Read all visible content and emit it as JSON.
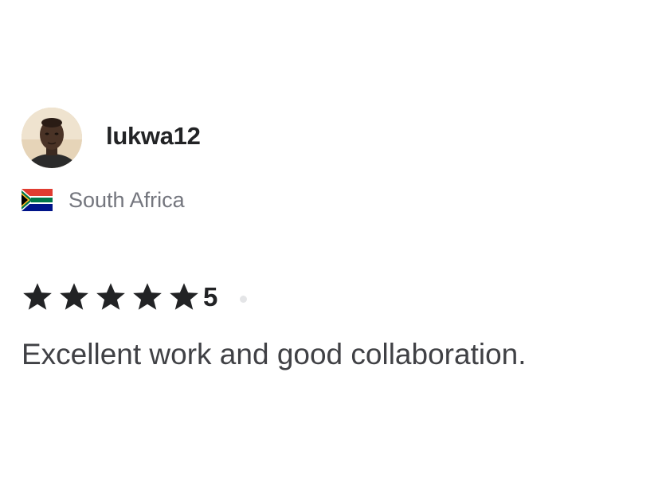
{
  "reviewer": {
    "username": "lukwa12",
    "country": "South Africa",
    "avatar_icon": "user-avatar-photo",
    "flag_icon": "south-africa-flag-icon"
  },
  "rating": {
    "stars": 5,
    "max_stars": 5,
    "value": "5",
    "star_color": "#222325"
  },
  "review": {
    "text": "Excellent work and good collaboration."
  },
  "colors": {
    "username": "#222325",
    "country": "#74767e",
    "body_text": "#404145",
    "separator_dot": "#e4e5e7"
  }
}
